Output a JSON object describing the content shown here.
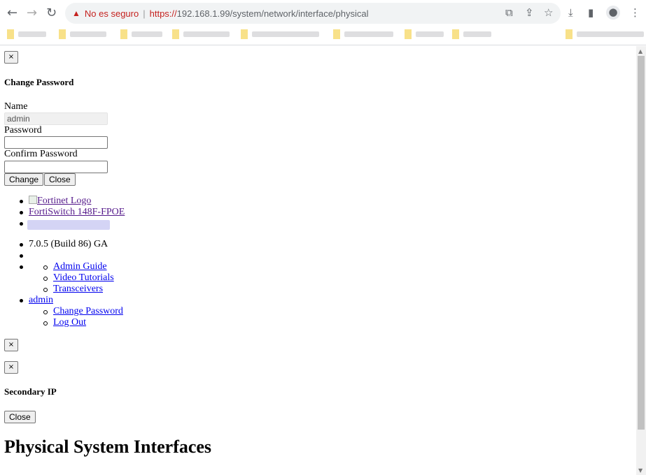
{
  "browser": {
    "security_label": "No es seguro",
    "url_scheme": "https://",
    "url_rest": "192.168.1.99/system/network/interface/physical",
    "icons": [
      "back-icon",
      "forward-icon",
      "reload-icon",
      "translate-icon",
      "share-icon",
      "star-icon",
      "download-icon",
      "sidebar-icon",
      "profile-icon",
      "menu-icon"
    ]
  },
  "change_password_modal": {
    "close_symbol": "×",
    "title": "Change Password",
    "name_label": "Name",
    "name_value": "admin",
    "password_label": "Password",
    "confirm_label": "Confirm Password",
    "change_label": "Change",
    "close_label": "Close"
  },
  "header": {
    "logo_alt": "Fortinet Logo",
    "device": "FortiSwitch 148F-FPOE",
    "version": "7.0.5 (Build 86) GA",
    "help_links": [
      "Admin Guide",
      "Video Tutorials",
      "Transceivers"
    ],
    "user": "admin",
    "user_links": [
      "Change Password",
      "Log Out"
    ]
  },
  "secondary_ip_modal": {
    "close_symbol": "×",
    "title": "Secondary IP",
    "close_label": "Close"
  },
  "page_title": "Physical System Interfaces"
}
